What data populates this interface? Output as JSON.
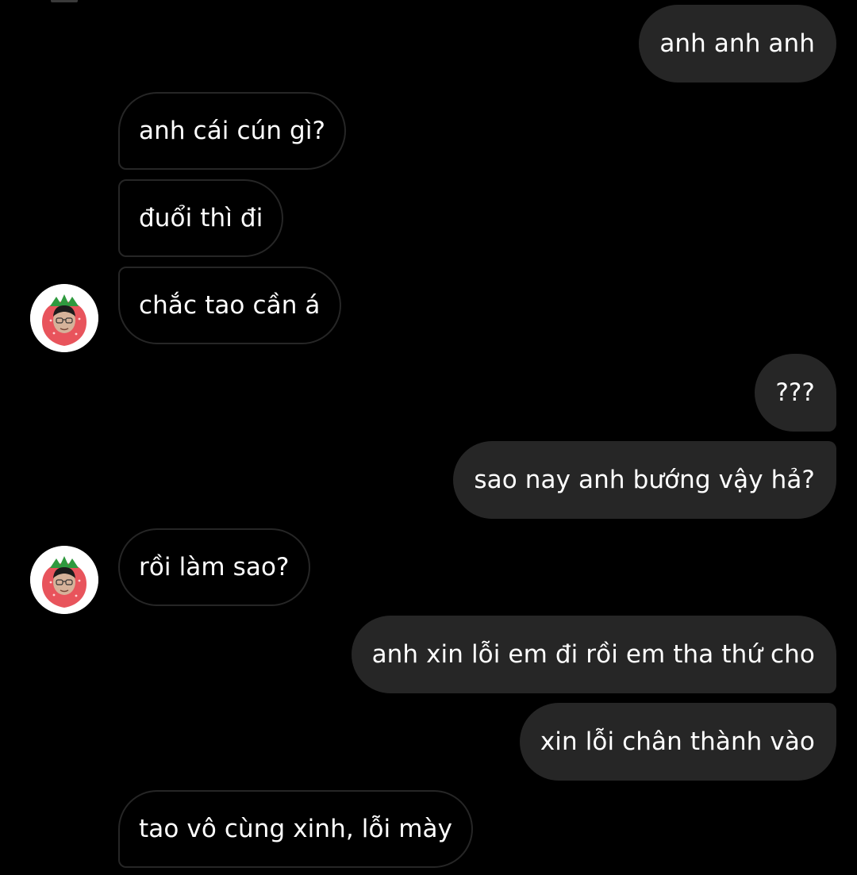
{
  "conversation": {
    "messages": [
      {
        "sender": "me",
        "text": "anh anh anh"
      },
      {
        "sender": "them",
        "text": "anh cái cún gì?"
      },
      {
        "sender": "them",
        "text": "đuổi thì đi"
      },
      {
        "sender": "them",
        "text": "chắc tao cần á"
      },
      {
        "sender": "me",
        "text": "???"
      },
      {
        "sender": "me",
        "text": "sao nay anh bướng vậy hả?"
      },
      {
        "sender": "them",
        "text": "rồi làm sao?"
      },
      {
        "sender": "me",
        "text": "anh xin lỗi em đi rồi em tha thứ cho"
      },
      {
        "sender": "me",
        "text": "xin lỗi chân thành vào"
      },
      {
        "sender": "them",
        "text": "tao vô cùng xinh, lỗi mày"
      }
    ]
  },
  "contact": {
    "avatar_icon": "strawberry-avatar-icon"
  },
  "colors": {
    "background": "#000000",
    "sent_bubble": "#262626",
    "received_border": "#262626",
    "text": "#ffffff"
  }
}
